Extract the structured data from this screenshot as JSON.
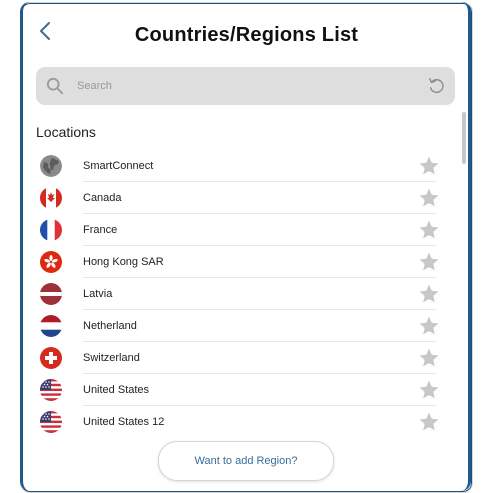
{
  "header": {
    "title": "Countries/Regions  List",
    "back_icon": "chevron-left-icon"
  },
  "search": {
    "placeholder": "Search",
    "value": "",
    "search_icon": "search-icon",
    "reset_icon": "refresh-icon"
  },
  "section": {
    "label": "Locations"
  },
  "locations": [
    {
      "name": "SmartConnect",
      "icon": "globe-icon",
      "favorite": false
    },
    {
      "name": "Canada",
      "icon": "flag-canada-icon",
      "favorite": false
    },
    {
      "name": "France",
      "icon": "flag-france-icon",
      "favorite": false
    },
    {
      "name": "Hong Kong SAR",
      "icon": "flag-hong-kong-icon",
      "favorite": false
    },
    {
      "name": "Latvia",
      "icon": "flag-latvia-icon",
      "favorite": false
    },
    {
      "name": "Netherland",
      "icon": "flag-netherlands-icon",
      "favorite": false
    },
    {
      "name": "Switzerland",
      "icon": "flag-switzerland-icon",
      "favorite": false
    },
    {
      "name": "United States",
      "icon": "flag-united-states-icon",
      "favorite": false
    },
    {
      "name": "United States 12",
      "icon": "flag-united-states-icon",
      "favorite": false
    }
  ],
  "footer": {
    "add_region_label": "Want to add Region?"
  },
  "colors": {
    "accent": "#3a6d98",
    "star": "#c8c8c8",
    "search_bg": "#dedede"
  }
}
